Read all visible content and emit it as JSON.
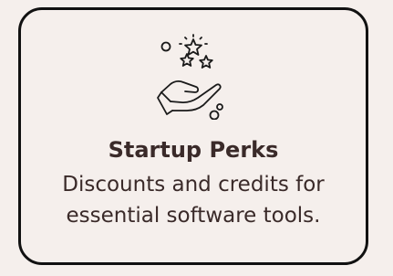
{
  "card": {
    "title": "Startup Perks",
    "description": "Discounts and credits for essential software tools.",
    "icon": "hand-with-stars-icon"
  },
  "colors": {
    "background": "#f5efec",
    "border": "#111111",
    "text": "#3a2a29",
    "icon": "#1a1a1a"
  }
}
